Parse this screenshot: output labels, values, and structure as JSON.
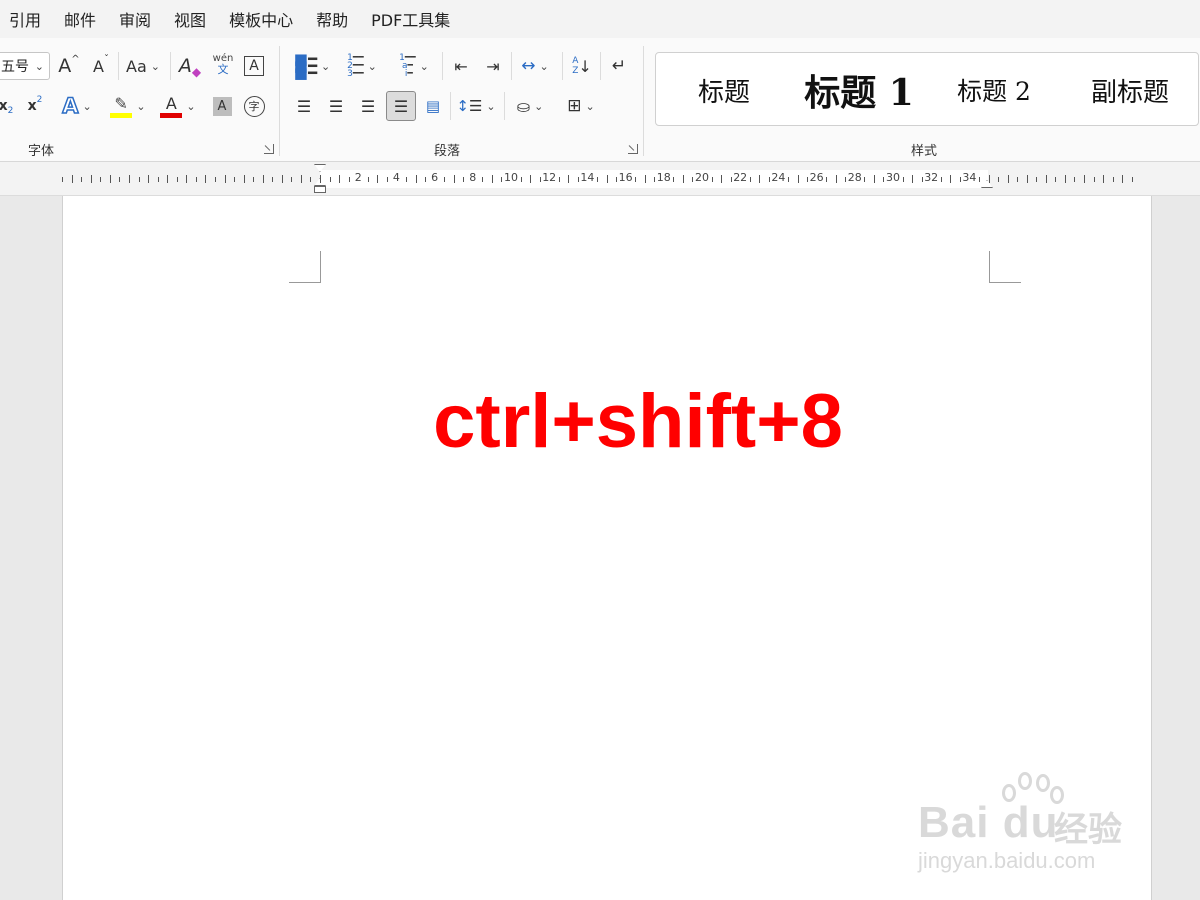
{
  "menu": [
    "引用",
    "邮件",
    "审阅",
    "视图",
    "模板中心",
    "帮助",
    "PDF工具集"
  ],
  "font_group": {
    "label": "字体",
    "font_size": "五号",
    "grow": "A",
    "shrink": "A",
    "change_case": "Aa",
    "clear_format": "A",
    "phonetic_top": "wén",
    "phonetic_bottom": "文",
    "char_border": "A",
    "subscript": "x",
    "superscript": "x",
    "text_effect": "A",
    "font_color": "A",
    "char_shading": "A",
    "enclose_char": "字"
  },
  "paragraph_group": {
    "label": "段落"
  },
  "styles_group": {
    "label": "样式",
    "items": [
      "标题",
      "标题 1",
      "标题 2",
      "副标题"
    ]
  },
  "ruler_numbers": [
    "2",
    "4",
    "6",
    "8",
    "10",
    "12",
    "14",
    "16",
    "18",
    "20",
    "22",
    "24",
    "26",
    "28",
    "30",
    "32",
    "34"
  ],
  "document": {
    "text": "ctrl+shift+8"
  },
  "watermark": {
    "brand": "Bai  du",
    "cn": "经验",
    "url": "jingyan.baidu.com"
  },
  "colors": {
    "text_red": "#ff0000",
    "highlight": "#ffff00",
    "font_color_bar": "#e00000",
    "accent_blue": "#2b6cc4"
  }
}
